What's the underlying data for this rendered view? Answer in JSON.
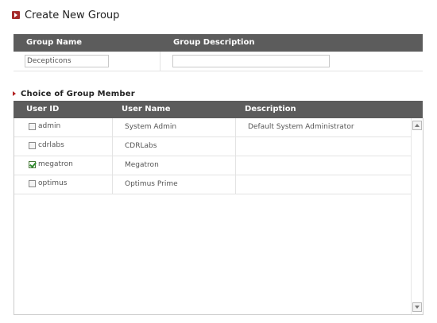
{
  "page": {
    "title": "Create New Group",
    "title_icon": "square-arrow-icon"
  },
  "group_form": {
    "headers": {
      "name": "Group Name",
      "description": "Group Description"
    },
    "name_value": "Decepticons",
    "description_value": ""
  },
  "members": {
    "section_title": "Choice of Group Member",
    "headers": {
      "user_id": "User ID",
      "user_name": "User Name",
      "description": "Description"
    },
    "rows": [
      {
        "user_id": "admin",
        "user_name": "System Admin",
        "description": "Default System Administrator",
        "checked": false
      },
      {
        "user_id": "cdrlabs",
        "user_name": "CDRLabs",
        "description": "",
        "checked": false
      },
      {
        "user_id": "megatron",
        "user_name": "Megatron",
        "description": "",
        "checked": true
      },
      {
        "user_id": "optimus",
        "user_name": "Optimus Prime",
        "description": "",
        "checked": false
      }
    ]
  },
  "colors": {
    "header_bar": "#5c5c5c",
    "accent": "#a52a2a",
    "check": "#2e8b2e"
  }
}
